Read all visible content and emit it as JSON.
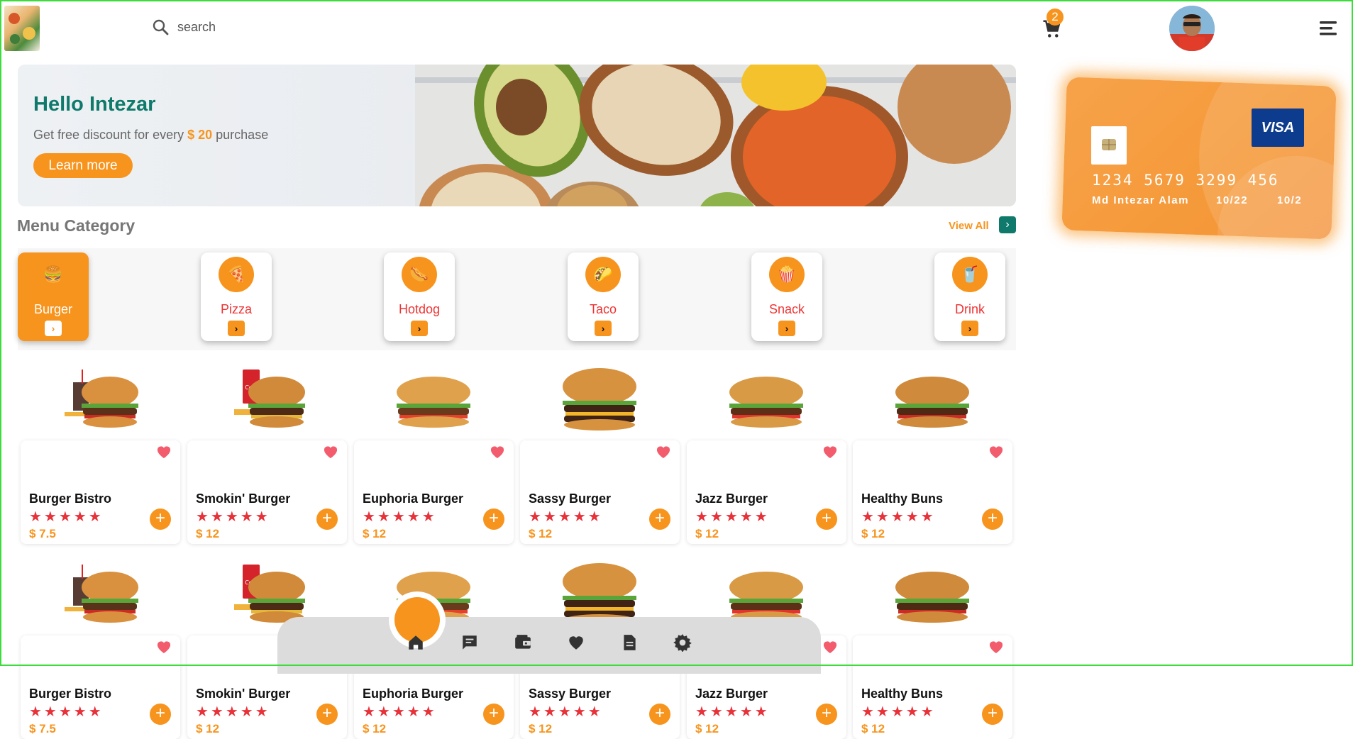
{
  "header": {
    "search_placeholder": "search",
    "cart_count": "2",
    "icons": [
      "search-icon",
      "cart-icon",
      "menu-icon"
    ]
  },
  "banner": {
    "greeting": "Hello Intezar",
    "promo_prefix": "Get free discount for every ",
    "promo_amount": "$ 20",
    "promo_suffix": " purchase",
    "button_label": "Learn more"
  },
  "card": {
    "number": "1234 5679 3299 456",
    "holder": "Md Intezar Alam",
    "expiry_1": "10/22",
    "expiry_2": "10/2",
    "brand": "VISA"
  },
  "menu_category": {
    "title": "Menu Category",
    "view_all": "View All",
    "categories": [
      {
        "label": "Burger",
        "active": true
      },
      {
        "label": "Pizza",
        "active": false
      },
      {
        "label": "Hotdog",
        "active": false
      },
      {
        "label": "Taco",
        "active": false
      },
      {
        "label": "Snack",
        "active": false
      },
      {
        "label": "Drink",
        "active": false
      }
    ]
  },
  "foods": [
    {
      "name": "Burger Bistro",
      "rating": 5,
      "price": "$ 7.5"
    },
    {
      "name": "Smokin' Burger",
      "rating": 5,
      "price": "$ 12"
    },
    {
      "name": "Euphoria Burger",
      "rating": 5,
      "price": "$ 12"
    },
    {
      "name": "Sassy Burger",
      "rating": 5,
      "price": "$ 12"
    },
    {
      "name": "Jazz Burger",
      "rating": 5,
      "price": "$ 12"
    },
    {
      "name": "Healthy Buns",
      "rating": 5,
      "price": "$ 12"
    }
  ],
  "bottom_nav": {
    "icons": [
      "home-icon",
      "chat-icon",
      "wallet-icon",
      "heart-icon",
      "document-icon",
      "settings-icon"
    ]
  },
  "colors": {
    "accent": "#f7941d",
    "teal": "#0f7a6c",
    "star": "#e8323a"
  }
}
